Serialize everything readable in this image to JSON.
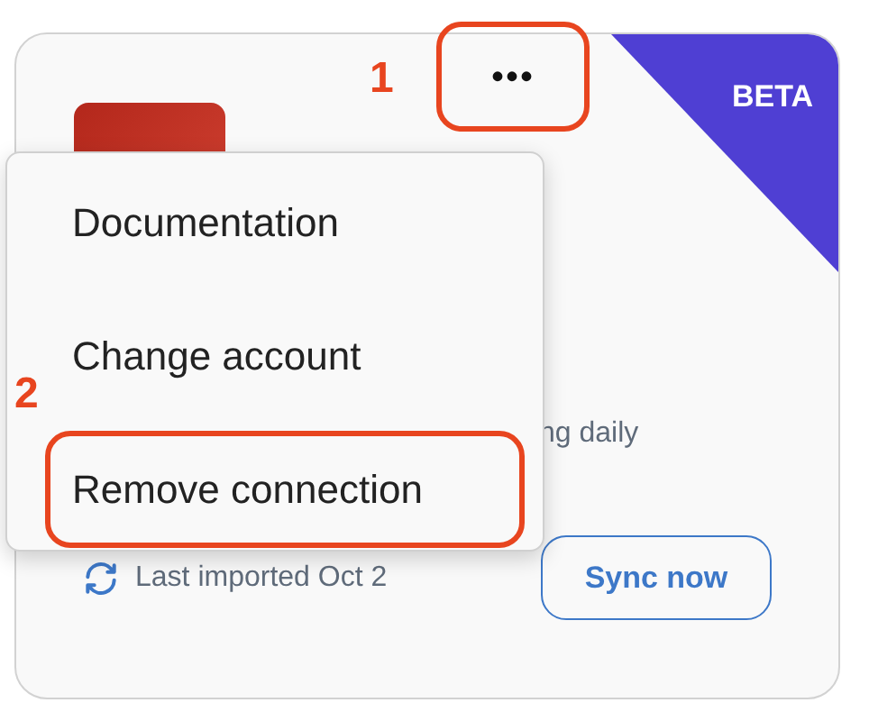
{
  "card": {
    "menu_button": {
      "label": "•••",
      "highlighted": true
    },
    "badge": "BETA",
    "status": "ng daily",
    "last_imported": "Last imported Oct 2",
    "sync_button": "Sync now"
  },
  "menu": {
    "items": [
      {
        "label": "Documentation",
        "highlighted": false
      },
      {
        "label": "Change account",
        "highlighted": false
      },
      {
        "label": "Remove connection",
        "highlighted": true
      }
    ]
  },
  "annotations": [
    {
      "label": "1",
      "kind": "button"
    },
    {
      "label": "2",
      "kind": "menu"
    }
  ]
}
